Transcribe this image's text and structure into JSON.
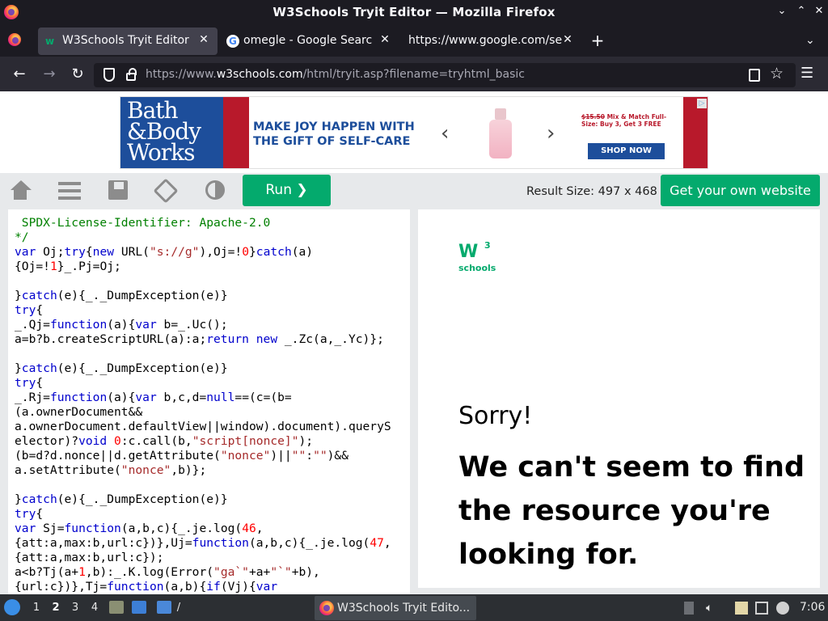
{
  "window": {
    "title": "W3Schools Tryit Editor — Mozilla Firefox"
  },
  "tabs": [
    {
      "label": "W3Schools Tryit Editor",
      "active": true,
      "favicon": "w3schools-icon"
    },
    {
      "label": "omegle - Google Search",
      "active": false,
      "favicon": "google-icon"
    },
    {
      "label": "https://www.google.com/sea",
      "active": false,
      "favicon": "none"
    }
  ],
  "nav": {
    "url_prefix": "https://www.",
    "url_host": "w3schools.com",
    "url_path": "/html/tryit.asp?filename=tryhtml_basic"
  },
  "ad": {
    "brand_lines": [
      "Bath",
      "&Body",
      "Works"
    ],
    "headline_lines": [
      "MAKE JOY HAPPEN WITH",
      "THE GIFT OF SELF-CARE"
    ],
    "promo_strike": "$15.50",
    "promo_text": "Mix & Match Full-Size: Buy 3, Get 3 FREE",
    "shop_label": "SHOP NOW",
    "prev_arrow": "‹",
    "next_arrow": "›"
  },
  "toolbar": {
    "run_label": "Run ❯",
    "result_size": "Result Size: 497 x 468",
    "own_website_label": "Get your own website"
  },
  "code_lines": [
    [
      [
        "c",
        " SPDX-License-Identifier: Apache-2.0"
      ]
    ],
    [
      [
        "c",
        "*/"
      ]
    ],
    [
      [
        "k",
        "var"
      ],
      [
        "p",
        " Oj;"
      ],
      [
        "k",
        "try"
      ],
      [
        "p",
        "{"
      ],
      [
        "k",
        "new"
      ],
      [
        "p",
        " URL("
      ],
      [
        "s",
        "\"s://g\""
      ],
      [
        "p",
        "),Oj=!"
      ],
      [
        "n",
        "0"
      ],
      [
        "p",
        "}"
      ],
      [
        "k",
        "catch"
      ],
      [
        "p",
        "(a)"
      ]
    ],
    [
      [
        "p",
        "{Oj=!"
      ],
      [
        "n",
        "1"
      ],
      [
        "p",
        "}_.Pj=Oj;"
      ]
    ],
    [
      [
        "p",
        ""
      ]
    ],
    [
      [
        "p",
        "}"
      ],
      [
        "k",
        "catch"
      ],
      [
        "p",
        "(e){_._DumpException(e)}"
      ]
    ],
    [
      [
        "k",
        "try"
      ],
      [
        "p",
        "{"
      ]
    ],
    [
      [
        "p",
        "_.Qj="
      ],
      [
        "k",
        "function"
      ],
      [
        "p",
        "(a){"
      ],
      [
        "k",
        "var"
      ],
      [
        "p",
        " b=_.Uc();"
      ]
    ],
    [
      [
        "p",
        "a=b?b.createScriptURL(a):a;"
      ],
      [
        "k",
        "return"
      ],
      [
        "p",
        " "
      ],
      [
        "k",
        "new"
      ],
      [
        "p",
        " _.Zc(a,_.Yc)};"
      ]
    ],
    [
      [
        "p",
        ""
      ]
    ],
    [
      [
        "p",
        "}"
      ],
      [
        "k",
        "catch"
      ],
      [
        "p",
        "(e){_._DumpException(e)}"
      ]
    ],
    [
      [
        "k",
        "try"
      ],
      [
        "p",
        "{"
      ]
    ],
    [
      [
        "p",
        "_.Rj="
      ],
      [
        "k",
        "function"
      ],
      [
        "p",
        "(a){"
      ],
      [
        "k",
        "var"
      ],
      [
        "p",
        " b,c,d="
      ],
      [
        "k",
        "null"
      ],
      [
        "p",
        "==(c=(b="
      ]
    ],
    [
      [
        "p",
        "(a.ownerDocument&&"
      ]
    ],
    [
      [
        "p",
        "a.ownerDocument.defaultView||window).document).queryS"
      ]
    ],
    [
      [
        "p",
        "elector)?"
      ],
      [
        "k",
        "void"
      ],
      [
        "p",
        " "
      ],
      [
        "n",
        "0"
      ],
      [
        "p",
        ":c.call(b,"
      ],
      [
        "s",
        "\"script[nonce]\""
      ],
      [
        "p",
        ");"
      ]
    ],
    [
      [
        "p",
        "(b=d?d.nonce||d.getAttribute("
      ],
      [
        "s",
        "\"nonce\""
      ],
      [
        "p",
        ")||"
      ],
      [
        "s",
        "\"\""
      ],
      [
        "p",
        ":"
      ],
      [
        "s",
        "\"\""
      ],
      [
        "p",
        ")&&"
      ]
    ],
    [
      [
        "p",
        "a.setAttribute("
      ],
      [
        "s",
        "\"nonce\""
      ],
      [
        "p",
        ",b)};"
      ]
    ],
    [
      [
        "p",
        ""
      ]
    ],
    [
      [
        "p",
        "}"
      ],
      [
        "k",
        "catch"
      ],
      [
        "p",
        "(e){_._DumpException(e)}"
      ]
    ],
    [
      [
        "k",
        "try"
      ],
      [
        "p",
        "{"
      ]
    ],
    [
      [
        "k",
        "var"
      ],
      [
        "p",
        " Sj="
      ],
      [
        "k",
        "function"
      ],
      [
        "p",
        "(a,b,c){_.je.log("
      ],
      [
        "n",
        "46"
      ],
      [
        "p",
        ","
      ]
    ],
    [
      [
        "p",
        "{att:a,max:b,url:c})},Uj="
      ],
      [
        "k",
        "function"
      ],
      [
        "p",
        "(a,b,c){_.je.log("
      ],
      [
        "n",
        "47"
      ],
      [
        "p",
        ","
      ]
    ],
    [
      [
        "p",
        "{att:a,max:b,url:c});"
      ]
    ],
    [
      [
        "p",
        "a<b?Tj(a+"
      ],
      [
        "n",
        "1"
      ],
      [
        "p",
        ",b):_.K.log(Error("
      ],
      [
        "s",
        "\"ga`\""
      ],
      [
        "p",
        "+a+"
      ],
      [
        "s",
        "\"`\""
      ],
      [
        "p",
        "+b),"
      ]
    ],
    [
      [
        "p",
        "{url:c})},Tj="
      ],
      [
        "k",
        "function"
      ],
      [
        "p",
        "(a,b){"
      ],
      [
        "k",
        "if"
      ],
      [
        "p",
        "(Vj){"
      ],
      [
        "k",
        "var"
      ]
    ]
  ],
  "result": {
    "logo_w": "W",
    "logo_3": "3",
    "logo_schools": "schools",
    "sorry": "Sorry!",
    "message": "We can't seem to find the resource you're looking for."
  },
  "taskbar": {
    "workspaces": [
      "1",
      "2",
      "3",
      "4"
    ],
    "active_workspace": "2",
    "task_label": "W3Schools Tryit Edito...",
    "clock": "7:06"
  },
  "colors": {
    "w3_green": "#04aa6d",
    "firefox_chrome": "#1c1b22",
    "editor_background": "#e7e9eb"
  }
}
